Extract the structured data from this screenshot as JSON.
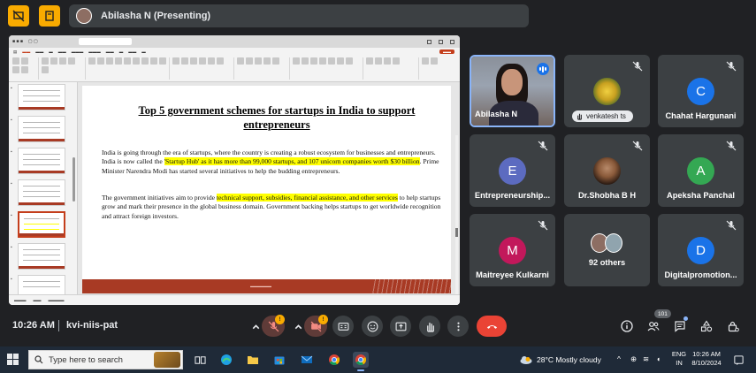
{
  "top_bar": {
    "presenter_label": "Abilasha N (Presenting)"
  },
  "slide": {
    "title": "Top 5 government schemes for startups in India to support entrepreneurs",
    "p1_a": "India is going through the era of startups, where the country is creating a robust ecosystem for businesses and entrepreneurs. India is now called the ",
    "p1_highlight": "'Startup Hub' as it has more than 99,000 startups, and 107 unicorn companies worth $30 billion",
    "p1_b": ". Prime Minister Narendra Modi has started several initiatives to help the budding entrepreneurs.",
    "p2_a": "The government initiatives aim to provide ",
    "p2_highlight": "technical support, subsidies, financial assistance, and other services",
    "p2_b": " to help startups grow and mark their presence in the global business domain. Government backing helps startups to get worldwide recognition and attract foreign investors."
  },
  "participants": [
    {
      "name": "Abilasha N",
      "type": "video",
      "speaking": true
    },
    {
      "name": "venkatesh ts",
      "type": "photo",
      "hand_raised": true,
      "muted": true
    },
    {
      "name": "Chahat Hargunani",
      "initial": "C",
      "color": "#1a73e8",
      "muted": true
    },
    {
      "name": "Entrepreneurship...",
      "initial": "E",
      "color": "#5c6bc0",
      "muted": true
    },
    {
      "name": "Dr.Shobha B H",
      "type": "photo",
      "muted": true
    },
    {
      "name": "Apeksha Panchal",
      "initial": "A",
      "color": "#34a853",
      "muted": true
    },
    {
      "name": "Maitreyee Kulkarni",
      "initial": "M",
      "color": "#c2185b",
      "muted": true
    },
    {
      "name": "92 others",
      "type": "group"
    },
    {
      "name": "Digitalpromotion...",
      "initial": "D",
      "color": "#1a73e8",
      "muted": true
    }
  ],
  "controls": {
    "time": "10:26 AM",
    "meeting_code": "kvi-niis-pat",
    "mic_badge": "!",
    "camera_badge": "!",
    "people_count": "101"
  },
  "taskbar": {
    "search_placeholder": "Type here to search",
    "weather": "28°C  Mostly cloudy",
    "lang_1": "ENG",
    "lang_2": "IN",
    "clock_time": "10:26 AM",
    "clock_date": "8/10/2024"
  },
  "colors": {
    "background": "#202124",
    "tile": "#3c4043",
    "accent_yellow": "#f9ab00",
    "end_call_red": "#ea4335",
    "slide_footer": "#a83a24"
  }
}
